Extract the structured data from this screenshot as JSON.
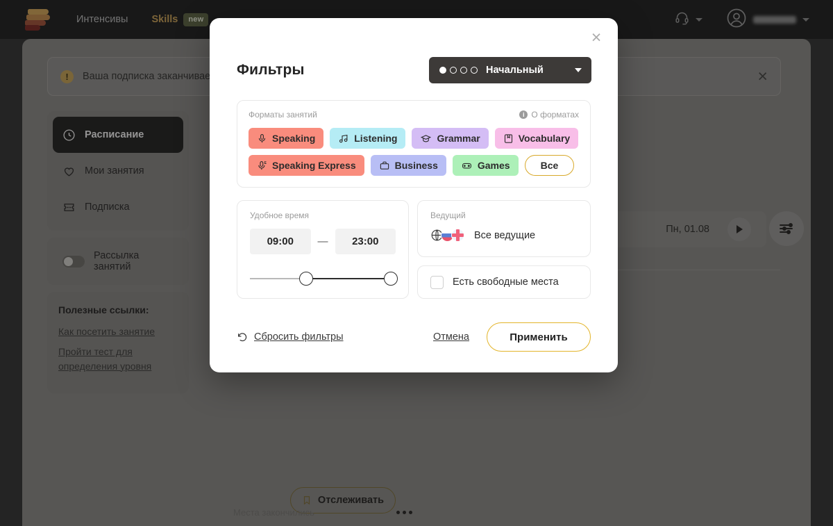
{
  "topbar": {
    "logo_icon": "skyeng-stack-logo",
    "nav": [
      {
        "label": "Интенсивы"
      },
      {
        "label": "Skills",
        "badge": "new"
      }
    ],
    "support_icon": "headset-icon",
    "avatar_icon": "user-avatar-icon"
  },
  "alert": {
    "icon": "warning-icon",
    "text": "Ваша подписка заканчивае",
    "close_icon": "close-icon"
  },
  "sidebar": {
    "items": [
      {
        "label": "Расписание",
        "icon": "clock-icon",
        "active": true
      },
      {
        "label": "Мои занятия",
        "icon": "heart-icon",
        "active": false
      },
      {
        "label": "Подписка",
        "icon": "ticket-icon",
        "active": false
      }
    ],
    "toggle": {
      "label": "Рассылка занятий",
      "icon": "toggle-switch",
      "on": false
    },
    "links_title": "Полезные ссылки:",
    "links": [
      {
        "label": "Как посетить занятие"
      },
      {
        "label": "Пройти тест для определения уровня"
      }
    ]
  },
  "schedule": {
    "date_label": "Пн, 01.08",
    "next_icon": "play-next-icon",
    "filter_icon": "sliders-icon",
    "card": {
      "track_label": "Отслеживать",
      "track_icon": "bookmark-icon",
      "status": "Места закончились",
      "menu_icon": "more-dots-icon"
    }
  },
  "modal": {
    "title": "Фильтры",
    "close_icon": "close-icon",
    "level": {
      "name": "Начальный",
      "filled_dots": 1,
      "total_dots": 4,
      "chevron_icon": "chevron-down-icon"
    },
    "formats": {
      "label": "Форматы занятий",
      "about_label": "О форматах",
      "about_icon": "info-icon",
      "rows": [
        [
          {
            "label": "Speaking",
            "icon": "microphone-icon",
            "color": "#F98C7D"
          },
          {
            "label": "Listening",
            "icon": "music-note-icon",
            "color": "#B5ECF5"
          },
          {
            "label": "Grammar",
            "icon": "graduation-cap-icon",
            "color": "#D4BDF5"
          },
          {
            "label": "Vocabulary",
            "icon": "book-icon",
            "color": "#F8BEE8"
          }
        ],
        [
          {
            "label": "Speaking Express",
            "icon": "microphone-express-icon",
            "color": "#F98C7D"
          },
          {
            "label": "Business",
            "icon": "briefcase-icon",
            "color": "#B8BEF5"
          },
          {
            "label": "Games",
            "icon": "gamepad-icon",
            "color": "#ADF0B8"
          },
          {
            "label": "Все",
            "icon": "none",
            "color": "#FFFFFF",
            "outline": "#D8A92A"
          }
        ]
      ]
    },
    "time": {
      "label": "Удобное время",
      "from": "09:00",
      "to": "23:00",
      "separator": "—"
    },
    "host": {
      "label": "Ведущий",
      "value": "Все ведущие",
      "icons": [
        "globe-icon",
        "flag-ru-icon",
        "flag-uk-icon"
      ]
    },
    "free_seats": {
      "label": "Есть свободные места",
      "checked": false
    },
    "footer": {
      "reset_label": "Сбросить фильтры",
      "reset_icon": "undo-icon",
      "cancel_label": "Отмена",
      "apply_label": "Применить"
    }
  },
  "colors": {
    "accent_gold": "#E3B429",
    "dark": "#3D3A38",
    "brand_orange": "#E8861B"
  }
}
